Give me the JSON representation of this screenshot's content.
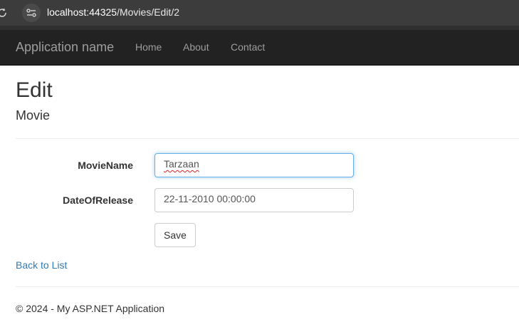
{
  "browser": {
    "url_host": "localhost:44325",
    "url_path": "/Movies/Edit/2"
  },
  "navbar": {
    "brand": "Application name",
    "links": [
      "Home",
      "About",
      "Contact"
    ]
  },
  "page": {
    "title": "Edit",
    "subtitle": "Movie"
  },
  "form": {
    "movie_name_label": "MovieName",
    "movie_name_value": "Tarzaan",
    "date_label": "DateOfRelease",
    "date_value": "22-11-2010 00:00:00",
    "save_label": "Save"
  },
  "back_link": "Back to List",
  "footer": "© 2024 - My ASP.NET Application",
  "colors": {
    "navbar_bg": "#222222",
    "link": "#337ab7",
    "focus_border": "#66afe9"
  }
}
